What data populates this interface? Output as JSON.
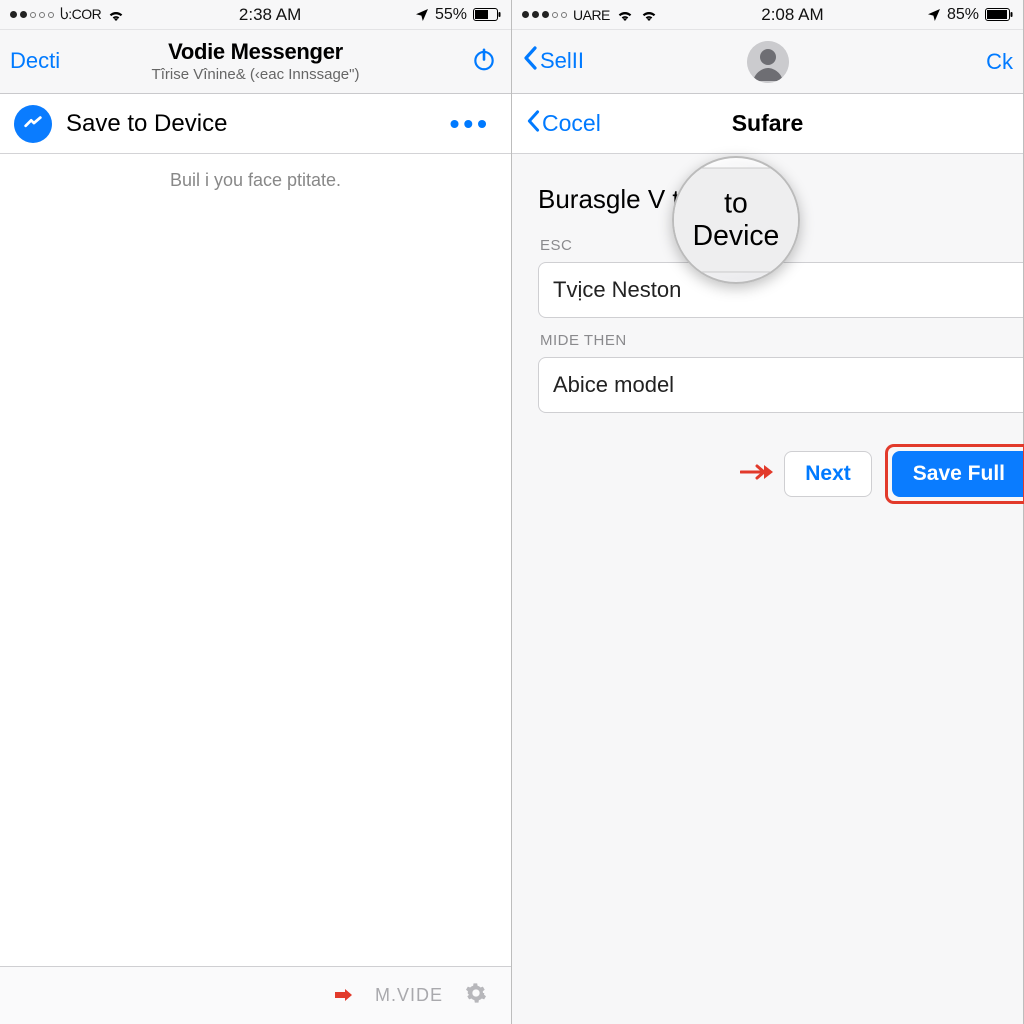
{
  "left": {
    "status": {
      "carrier": "Ⴑ:COR",
      "time": "2:38 AM",
      "battery": "55%"
    },
    "nav": {
      "back": "Decti",
      "title": "Vodie Messenger",
      "subtitle": "Tîrise Vînine& (‹eac Innssage\")"
    },
    "subnav": {
      "label": "Save to Device",
      "more": "•••"
    },
    "hint": "Buil i you face ptitate.",
    "bottombar": {
      "label": "M.VIDE"
    }
  },
  "right": {
    "status": {
      "carrier": "UARE",
      "time": "2:08 AM",
      "battery": "85%"
    },
    "nav": {
      "back": "SelII",
      "right": "Ck"
    },
    "subnav": {
      "back": "Cocel",
      "title": "Sufare"
    },
    "section_title": "Burasgle V  to Device",
    "magnifier_text": "to Device",
    "fields": {
      "f1": {
        "label": "ESC",
        "value": "Tvịce Neston"
      },
      "f2": {
        "label": "MIDE THEN",
        "value": "Abice model"
      }
    },
    "buttons": {
      "next": "Next",
      "save": "Save Full"
    }
  }
}
